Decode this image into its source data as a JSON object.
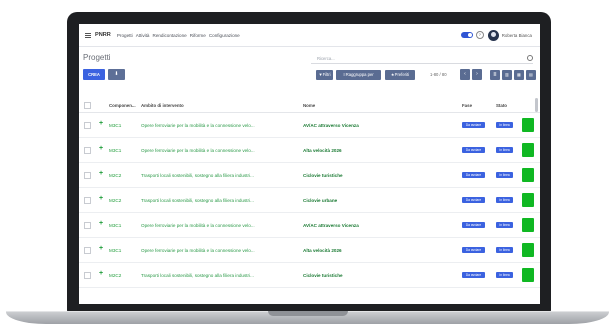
{
  "app": {
    "brand": "PNRR",
    "menu": [
      "Progetti",
      "Attività",
      "Rendicontazione",
      "Riforme",
      "Configurazione"
    ],
    "user": "Roberta Bianca",
    "toggle_color": "#2f55d4"
  },
  "page": {
    "title": "Progetti",
    "search_placeholder": "Ricerca...",
    "create_label": "CREA",
    "export_icon": "download-icon",
    "filters_label": "Filtri",
    "groupby_label": "Raggruppa per",
    "favorites_label": "Preferiti",
    "pager": "1-80 / 80",
    "prev_label": "‹",
    "next_label": "›"
  },
  "table": {
    "headers": [
      "Componen...",
      "Ambito di intervento",
      "Nome",
      "Fase",
      "Stato"
    ],
    "rows": [
      {
        "componente": "M3C1",
        "ambito": "Opere ferroviarie per la mobilità e la connessione velo...",
        "nome": "AV/AC attraverso Vicenza",
        "fase": "Da avviare",
        "stato": "In linea"
      },
      {
        "componente": "M3C1",
        "ambito": "Opere ferroviarie per la mobilità e la connessione velo...",
        "nome": "Alta velocità 2026",
        "fase": "Da avviare",
        "stato": "In linea"
      },
      {
        "componente": "M2C2",
        "ambito": "Trasporti locali sostenibili, sostegno alla filiera industri...",
        "nome": "Ciclovie turistiche",
        "fase": "Da avviare",
        "stato": "In linea"
      },
      {
        "componente": "M2C2",
        "ambito": "Trasporti locali sostenibili, sostegno alla filiera industri...",
        "nome": "Ciclovie urbane",
        "fase": "Da avviare",
        "stato": "In linea"
      },
      {
        "componente": "M3C1",
        "ambito": "Opere ferroviarie per la mobilità e la connessione velo...",
        "nome": "AV/AC attraverso Vicenza",
        "fase": "Da avviare",
        "stato": "In linea"
      },
      {
        "componente": "M3C1",
        "ambito": "Opere ferroviarie per la mobilità e la connessione velo...",
        "nome": "Alta velocità 2026",
        "fase": "Da avviare",
        "stato": "In linea"
      },
      {
        "componente": "M2C2",
        "ambito": "Trasporti locali sostenibili, sostegno alla filiera industri...",
        "nome": "Ciclovie turistiche",
        "fase": "Da avviare",
        "stato": "In linea"
      }
    ],
    "status_color": "#10b823",
    "badge_color": "#3b62e0"
  }
}
